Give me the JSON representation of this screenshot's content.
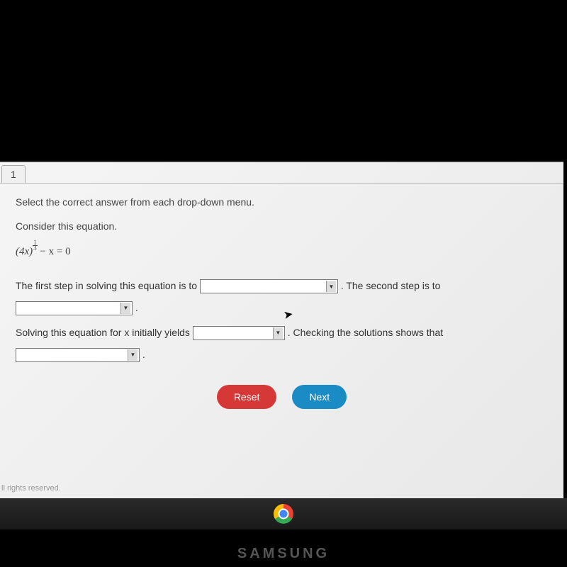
{
  "tab": {
    "number": "1"
  },
  "content": {
    "instruction": "Select the correct answer from each drop-down menu.",
    "consider": "Consider this equation.",
    "equation": {
      "base": "(4x)",
      "exp_num": "1",
      "exp_den": "3",
      "rest": " − x = 0"
    },
    "line1_part1": "The first step in solving this equation is to ",
    "line1_part2": " . The second step is to ",
    "line1_part3": " .",
    "line2_part1": "Solving this equation for x initially yields ",
    "line2_part2": " . Checking the solutions shows that ",
    "line2_part3": " ."
  },
  "buttons": {
    "reset": "Reset",
    "next": "Next"
  },
  "footer": "ll rights reserved.",
  "device_brand": "SAMSUNG"
}
